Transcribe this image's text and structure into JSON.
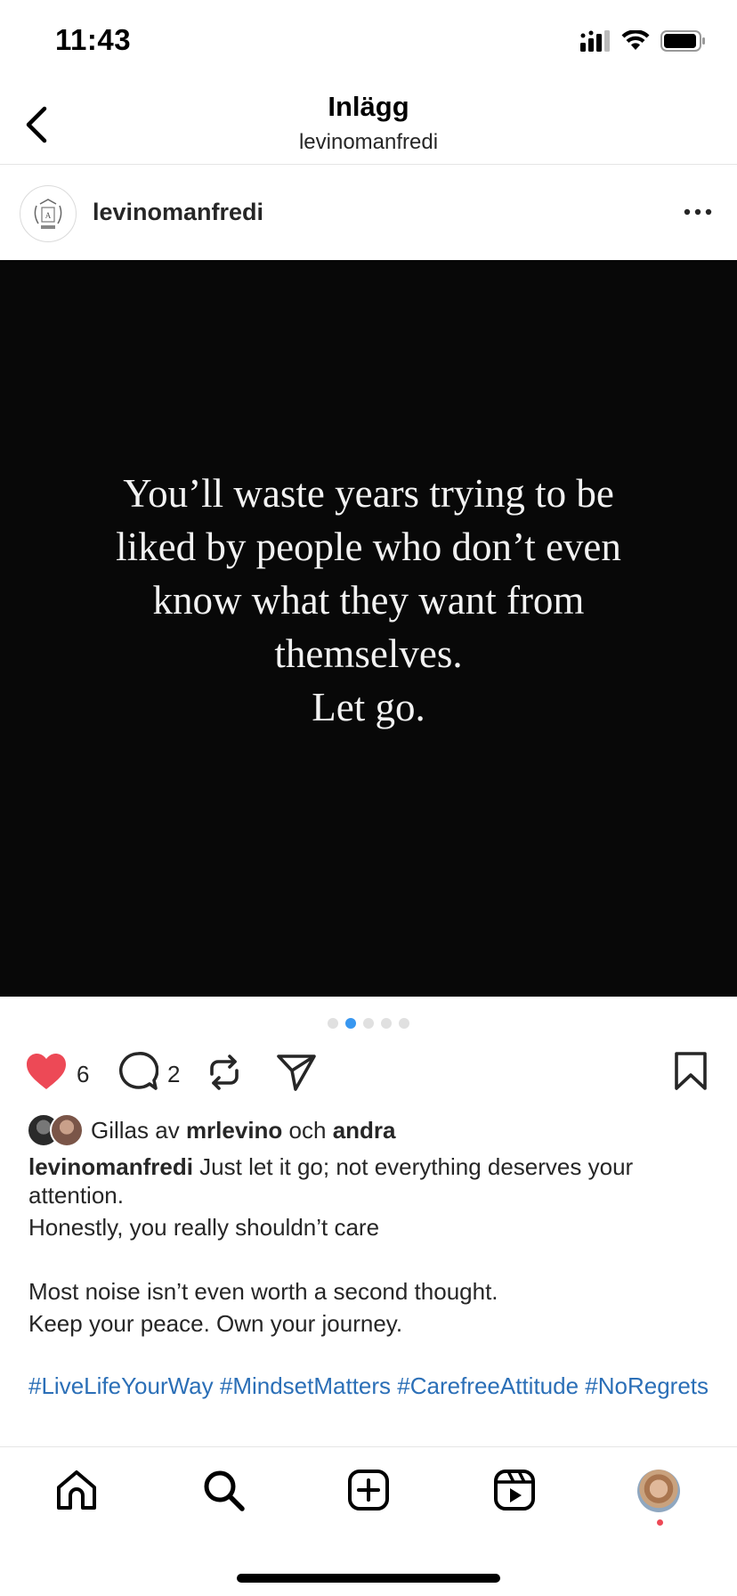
{
  "status_bar": {
    "time": "11:43"
  },
  "header": {
    "title": "Inlägg",
    "subtitle": "levinomanfredi"
  },
  "post": {
    "username": "levinomanfredi",
    "quote_lines": [
      "You’ll waste years trying to be",
      "liked by people who don’t even",
      "know what they want from",
      "themselves.",
      "Let go."
    ],
    "carousel": {
      "total": 5,
      "active_index": 2
    },
    "like_count": "6",
    "comment_count": "2",
    "liked_by": {
      "prefix": "Gillas av",
      "user": "mrlevino",
      "connector": "och",
      "others": "andra"
    },
    "caption": {
      "username": "levinomanfredi",
      "line1_rest": " Just let it go; not everything deserves your attention.",
      "line2": "Honestly, you really shouldn’t care",
      "line3": "Most noise isn’t even worth a second thought.",
      "line4": "Keep your peace.  Own your journey.",
      "hashtags": " #LiveLifeYourWay #MindsetMatters #CarefreeAttitude #NoRegrets"
    }
  },
  "colors": {
    "like_red": "#ed4956",
    "link_blue": "#2b6fb7",
    "active_dot": "#3897f0",
    "notification_dot": "#ed4956"
  },
  "icons": [
    "back-chevron-icon",
    "more-horizontal-icon",
    "heart-icon",
    "comment-icon",
    "repost-icon",
    "share-icon",
    "bookmark-icon",
    "home-icon",
    "search-icon",
    "create-icon",
    "reels-icon",
    "profile-avatar"
  ]
}
